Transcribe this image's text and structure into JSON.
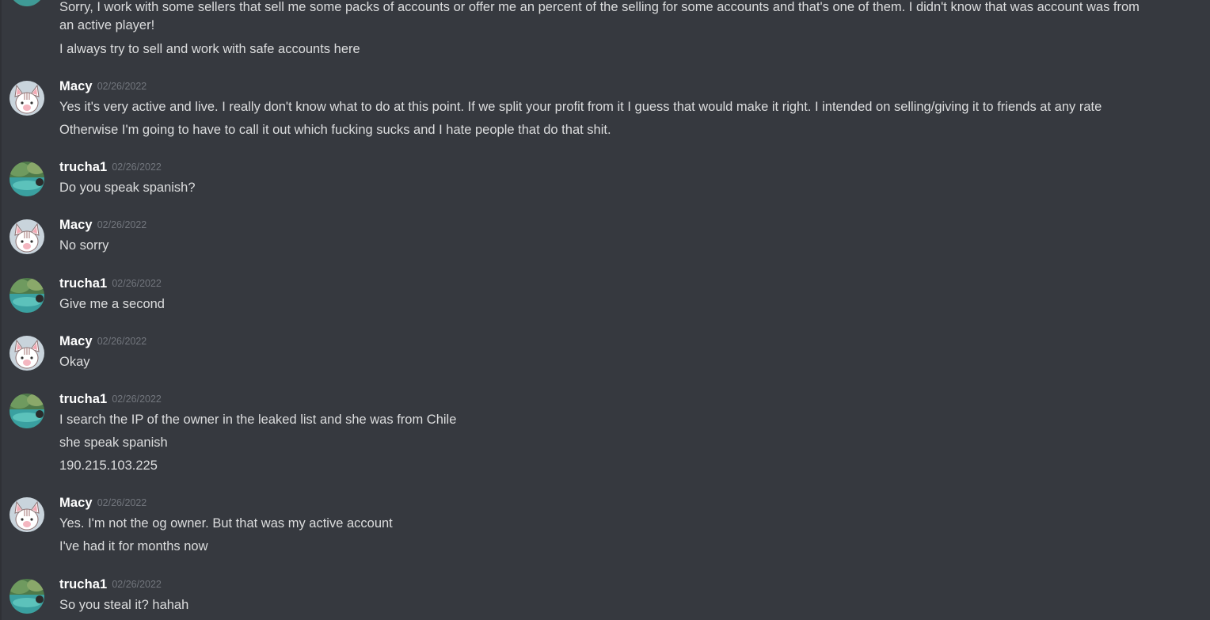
{
  "messages": [
    {
      "author": "",
      "timestamp": "",
      "lines": [
        "Sorry, I work with some sellers that sell me some packs of accounts or offer me an percent of the selling for some accounts and that's one of them. I didn't know that was account was from",
        "an active player!",
        "I always try to sell and work with safe accounts here"
      ]
    },
    {
      "author": "Macy",
      "timestamp": "02/26/2022",
      "lines": [
        "Yes it's very active and live. I really don't know what to do at this point. If we split your profit from it I guess that would make it right. I intended on selling/giving it to friends at any rate",
        "Otherwise I'm going to have to call it out which fucking sucks and I hate people that do that shit."
      ]
    },
    {
      "author": "trucha1",
      "timestamp": "02/26/2022",
      "lines": [
        "Do you speak spanish?"
      ]
    },
    {
      "author": "Macy",
      "timestamp": "02/26/2022",
      "lines": [
        "No sorry"
      ]
    },
    {
      "author": "trucha1",
      "timestamp": "02/26/2022",
      "lines": [
        "Give me a second"
      ]
    },
    {
      "author": "Macy",
      "timestamp": "02/26/2022",
      "lines": [
        "Okay"
      ]
    },
    {
      "author": "trucha1",
      "timestamp": "02/26/2022",
      "lines": [
        "I search the IP of the owner in the leaked list and she was from Chile",
        "she speak spanish",
        "190.215.103.225"
      ]
    },
    {
      "author": "Macy",
      "timestamp": "02/26/2022",
      "lines": [
        "Yes. I'm not the og owner. But that was my active account",
        "I've had it for months now"
      ]
    },
    {
      "author": "trucha1",
      "timestamp": "02/26/2022",
      "lines": [
        "So you steal it? hahah"
      ]
    }
  ],
  "colors": {
    "background": "#36393f",
    "author": "#ffffff",
    "message_text": "#dcddde",
    "timestamp": "#72767d"
  },
  "icons": {
    "macy_avatar": "cat-avatar-icon",
    "trucha1_avatar": "nature-avatar-icon"
  }
}
